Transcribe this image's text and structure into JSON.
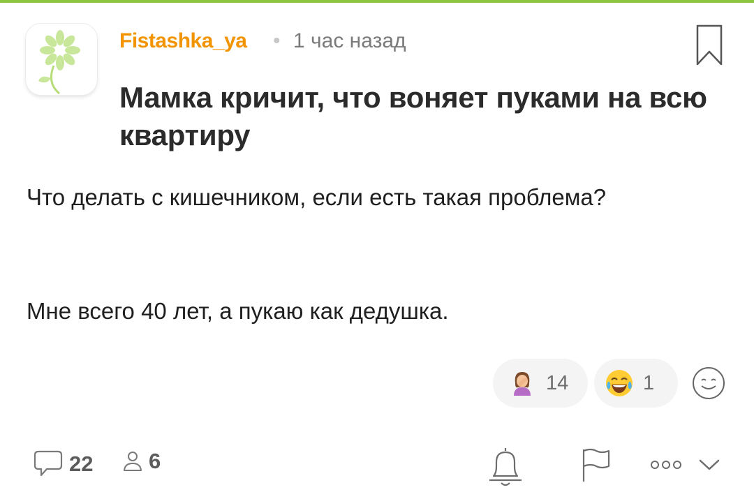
{
  "post": {
    "author": "Fistashka_ya",
    "separator": "•",
    "time": "1 час назад",
    "title": "Мамка кричит, что воняет пуками на всю квартиру",
    "paragraphs": [
      "Что делать с кишечником, если есть такая проблема?",
      "Мне всего 40 лет, а пукаю как дедушка."
    ]
  },
  "reactions": [
    {
      "icon": "facepalm-woman-emoji",
      "count": "14"
    },
    {
      "icon": "tears-of-joy-emoji",
      "count": "1"
    }
  ],
  "footer": {
    "comments_count": "22",
    "users_count": "6"
  },
  "colors": {
    "accent_green": "#8ec641",
    "author_orange": "#f29400"
  }
}
